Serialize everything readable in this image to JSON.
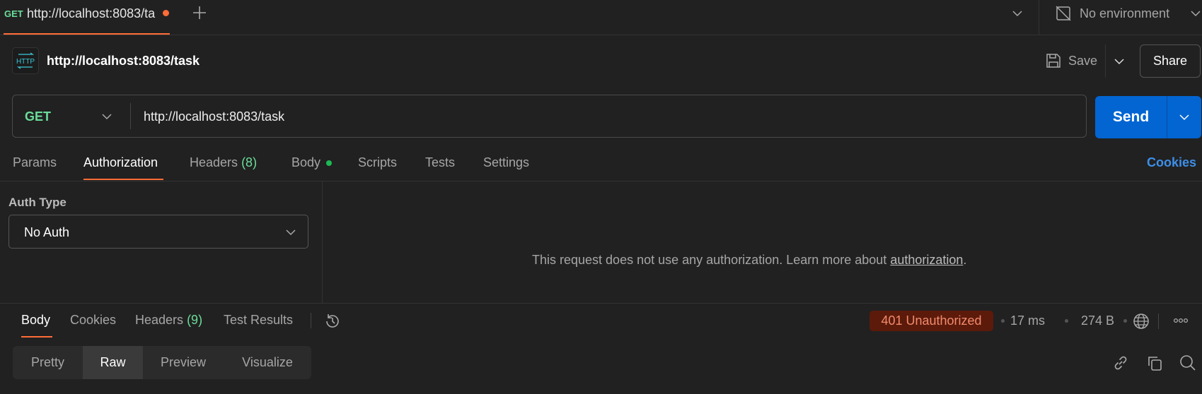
{
  "tab_bar": {
    "tab": {
      "method": "GET",
      "title": "http://localhost:8083/ta",
      "unsaved": true
    },
    "environment": "No environment"
  },
  "request": {
    "title": "http://localhost:8083/task",
    "save_label": "Save",
    "share_label": "Share",
    "method": "GET",
    "url": "http://localhost:8083/task",
    "send_label": "Send"
  },
  "request_tabs": [
    {
      "label": "Params"
    },
    {
      "label": "Authorization",
      "active": true
    },
    {
      "label": "Headers",
      "count": "(8)"
    },
    {
      "label": "Body",
      "dot": true
    },
    {
      "label": "Scripts"
    },
    {
      "label": "Tests"
    },
    {
      "label": "Settings"
    }
  ],
  "cookies_link": "Cookies",
  "auth": {
    "type_label": "Auth Type",
    "type_value": "No Auth",
    "message": "This request does not use any authorization. Learn more about ",
    "message_link": "authorization",
    "message_end": "."
  },
  "response": {
    "tabs": [
      {
        "label": "Body",
        "active": true
      },
      {
        "label": "Cookies"
      },
      {
        "label": "Headers",
        "count": "(9)"
      },
      {
        "label": "Test Results"
      }
    ],
    "status": "401 Unauthorized",
    "time": "17 ms",
    "size": "274 B",
    "view_modes": [
      "Pretty",
      "Raw",
      "Preview",
      "Visualize"
    ],
    "active_view": "Raw"
  },
  "colors": {
    "accent": "#ff6c37",
    "send": "#0265d2",
    "get": "#6bdd9a",
    "link": "#3d8fe8",
    "error_bg": "#5c1a0b",
    "error_text": "#f28b6c"
  }
}
